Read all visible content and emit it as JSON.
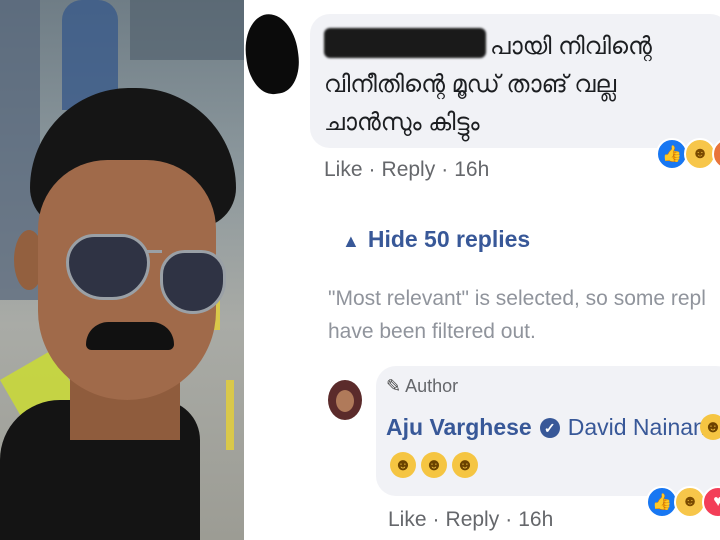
{
  "comment": {
    "text_line1": "പായി നിവിന്റെ",
    "text_line2": "വിനീതിന്റെ മൂഡ് താങ് വല്ല",
    "text_line3": "ചാൻസും കിട്ടും",
    "like_label": "Like",
    "reply_label": "Reply",
    "time": "16h"
  },
  "replies_toggle": {
    "label": "Hide 50 replies"
  },
  "filter_notice": {
    "line1": "\"Most relevant\" is selected, so some repl",
    "line2": "have been filtered out."
  },
  "reply": {
    "badge": "Author",
    "author_name": "Aju Varghese",
    "tagged_name": "David Nainan",
    "like_label": "Like",
    "reply_label": "Reply",
    "time": "16h"
  },
  "colors": {
    "link": "#385898",
    "meta": "#65676b",
    "bubble": "#f1f2f6"
  }
}
